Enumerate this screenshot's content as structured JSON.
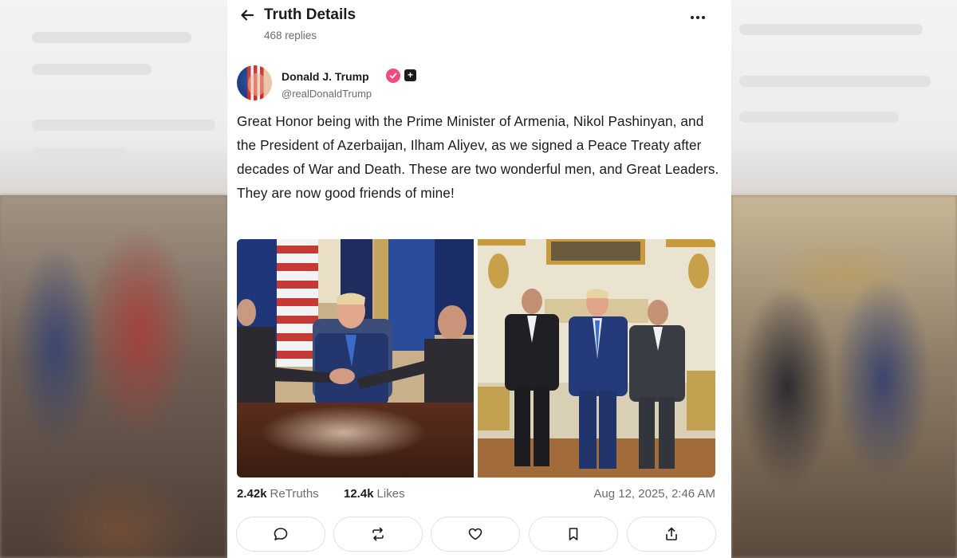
{
  "header": {
    "title": "Truth Details",
    "replies": "468 replies",
    "back_icon": "arrow-left-icon",
    "more_icon": "more-horizontal-icon"
  },
  "post": {
    "author_name": "Donald J. Trump",
    "author_handle": "@realDonaldTrump",
    "verified_color": "#f04d7e",
    "text": "Great Honor being with the Prime Minister of Armenia, Nikol Pashinyan, and the President of Azerbaijan, Ilham Aliyev, as we signed a Peace Treaty after decades of War and Death. These are two wonderful men, and Great Leaders. They are now good friends of mine!",
    "images": [
      {
        "name": "photo-handshake"
      },
      {
        "name": "photo-oval-office"
      }
    ]
  },
  "stats": {
    "retruths_count": "2.42k",
    "retruths_label": "ReTruths",
    "likes_count": "12.4k",
    "likes_label": "Likes",
    "timestamp": "Aug 12, 2025, 2:46 AM"
  },
  "actions": [
    {
      "icon": "reply-icon"
    },
    {
      "icon": "retruth-icon"
    },
    {
      "icon": "like-icon"
    },
    {
      "icon": "bookmark-icon"
    },
    {
      "icon": "share-icon"
    }
  ],
  "colors": {
    "text_primary": "#1b1b1f",
    "text_secondary": "#6b6b73",
    "border": "#e1e1e6"
  }
}
